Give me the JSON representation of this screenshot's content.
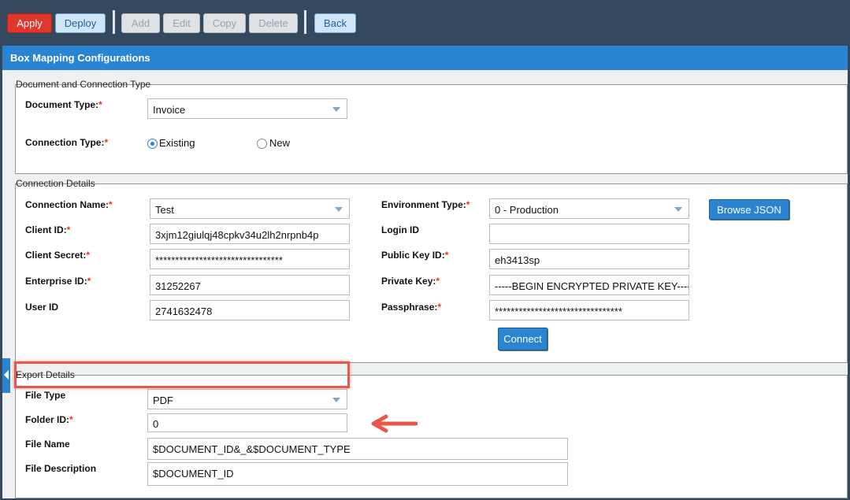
{
  "toolbar": {
    "apply": "Apply",
    "deploy": "Deploy",
    "add": "Add",
    "edit": "Edit",
    "copy": "Copy",
    "delete": "Delete",
    "back": "Back"
  },
  "panel": {
    "title": "Box Mapping Configurations"
  },
  "doc_section": {
    "legend": "Document and Connection Type",
    "document_type_label": "Document Type:",
    "document_type_value": "Invoice",
    "connection_type_label": "Connection Type:",
    "option_existing": "Existing",
    "option_new": "New",
    "selected": "Existing"
  },
  "connection_section": {
    "legend": "Connection Details",
    "connection_name_label": "Connection Name:",
    "connection_name_value": "Test",
    "client_id_label": "Client ID:",
    "client_id_value": "3xjm12giulqj48cpkv34u2lh2nrpnb4p",
    "client_secret_label": "Client Secret:",
    "client_secret_value": "********************************",
    "enterprise_id_label": "Enterprise ID:",
    "enterprise_id_value": "31252267",
    "user_id_label": "User ID",
    "user_id_value": "2741632478",
    "environment_type_label": "Environment Type:",
    "environment_type_value": "0 - Production",
    "login_id_label": "Login ID",
    "login_id_value": "",
    "public_key_id_label": "Public Key ID:",
    "public_key_id_value": "eh3413sp",
    "private_key_label": "Private Key:",
    "private_key_value": "-----BEGIN ENCRYPTED PRIVATE KEY-----",
    "passphrase_label": "Passphrase:",
    "passphrase_value": "********************************",
    "browse_json": "Browse JSON",
    "connect": "Connect"
  },
  "export_section": {
    "legend": "Export Details",
    "file_type_label": "File Type",
    "file_type_value": "PDF",
    "folder_id_label": "Folder ID:",
    "folder_id_value": "0",
    "file_name_label": "File Name",
    "file_name_value": "$DOCUMENT_ID&_&$DOCUMENT_TYPE",
    "file_description_label": "File Description",
    "file_description_value": "$DOCUMENT_ID"
  },
  "required_mark": "*",
  "colors": {
    "header_blue": "#2b84d2",
    "apply_red": "#e0362b",
    "highlight_red": "#e8574a",
    "toolbar_bg": "#34495e"
  }
}
